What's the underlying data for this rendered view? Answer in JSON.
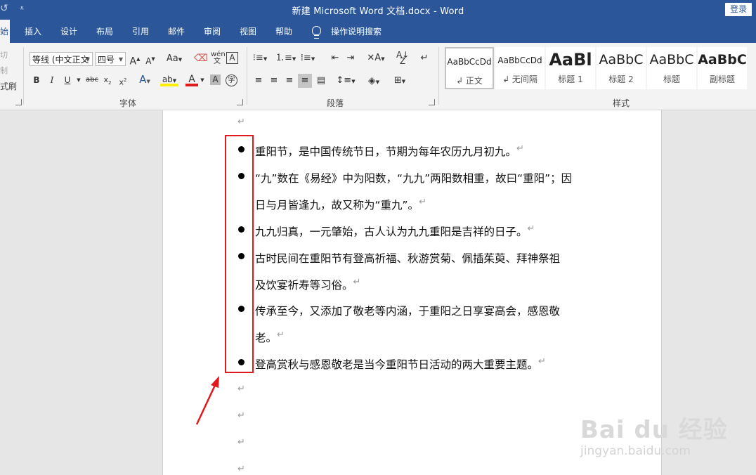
{
  "titlebar": {
    "title": "新建 Microsoft Word 文档.docx  -  Word",
    "login": "登录",
    "qa_more": "⩡"
  },
  "tabs": [
    {
      "label": "始"
    },
    {
      "label": "插入"
    },
    {
      "label": "设计"
    },
    {
      "label": "布局"
    },
    {
      "label": "引用"
    },
    {
      "label": "邮件"
    },
    {
      "label": "审阅"
    },
    {
      "label": "视图"
    },
    {
      "label": "帮助"
    },
    {
      "label": "操作说明搜索"
    }
  ],
  "clipboard": {
    "cut": "切",
    "copy": "制",
    "format_painter": "式刷"
  },
  "font": {
    "name": "等线 (中文正文",
    "size": "四号",
    "group_label": "字体"
  },
  "paragraph": {
    "group_label": "段落"
  },
  "styles": {
    "group_label": "样式",
    "items": [
      {
        "sample": "AaBbCcDd",
        "name": "↲ 正文"
      },
      {
        "sample": "AaBbCcDd",
        "name": "↲ 无间隔"
      },
      {
        "sample": "AaBl",
        "name": "标题 1"
      },
      {
        "sample": "AaBbC",
        "name": "标题 2"
      },
      {
        "sample": "AaBbC",
        "name": "标题"
      },
      {
        "sample": "AaBbC",
        "name": "副标题"
      }
    ]
  },
  "document": {
    "lines": [
      "重阳节，是中国传统节日，节期为每年农历九月初九。",
      "“九”数在《易经》中为阳数，“九九”两阳数相重，故曰“重阳”；因",
      "日与月皆逢九，故又称为“重九”。",
      "九九归真，一元肇始，古人认为九九重阳是吉祥的日子。",
      "古时民间在重阳节有登高祈福、秋游赏菊、佩插茱萸、拜神祭祖",
      "及饮宴祈寿等习俗。",
      "传承至今，又添加了敬老等内涵，于重阳之日享宴高会，感恩敬",
      "老。",
      "登高赏秋与感恩敬老是当今重阳节日活动的两大重要主题。"
    ],
    "para_mark": "↵"
  },
  "watermark": {
    "logo": "Bai du 经验",
    "url": "jingyan.baidu.com"
  }
}
